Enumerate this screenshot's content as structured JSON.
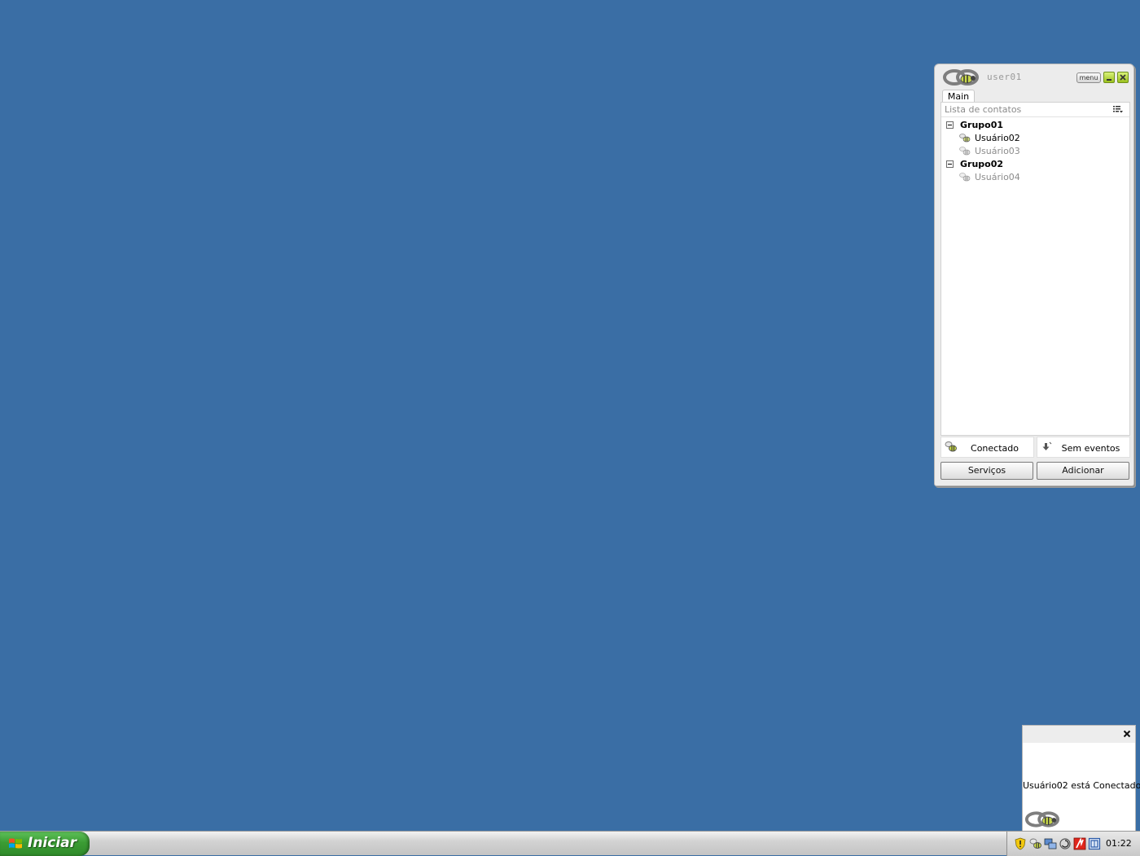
{
  "window": {
    "username": "user01",
    "menu_label": "menu",
    "tab_label": "Main",
    "list_title": "Lista de contatos"
  },
  "groups": [
    {
      "name": "Grupo01",
      "contacts": [
        {
          "name": "Usuário02",
          "status": "online"
        },
        {
          "name": "Usuário03",
          "status": "offline"
        }
      ]
    },
    {
      "name": "Grupo02",
      "contacts": [
        {
          "name": "Usuário04",
          "status": "offline"
        }
      ]
    }
  ],
  "status": {
    "connection": "Conectado",
    "events": "Sem eventos"
  },
  "buttons": {
    "services": "Serviços",
    "add": "Adicionar"
  },
  "notification": {
    "message": "Usuário02 está Conectado"
  },
  "taskbar": {
    "start_label": "Iniciar",
    "clock": "01:22"
  },
  "colors": {
    "desktop": "#3a6ea5",
    "accent_green": "#9dc21f"
  }
}
